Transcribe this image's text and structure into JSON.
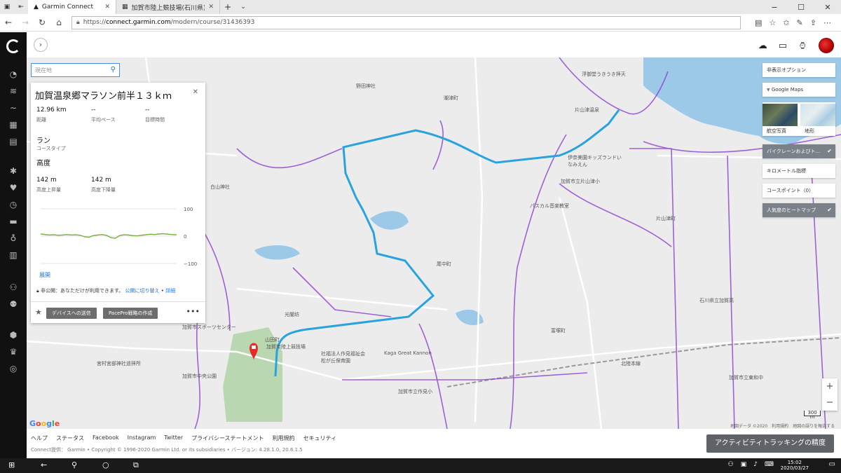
{
  "browser": {
    "tabs": [
      {
        "title": "Garmin Connect",
        "active": true
      },
      {
        "title": "加賀市陸上競技場(石川県)の",
        "active": false
      }
    ],
    "url_prefix": "https://",
    "url_host": "connect.garmin.com",
    "url_path": "/modern/course/31436393"
  },
  "search": {
    "placeholder": "現在地"
  },
  "course": {
    "title": "加賀温泉郷マラソン前半１３ｋｍ",
    "distance": {
      "value": "12.96 km",
      "label": "距離"
    },
    "avg_pace": {
      "value": "--",
      "label": "平均ペース"
    },
    "target_time": {
      "value": "--",
      "label": "目標時間"
    },
    "type": {
      "value": "ラン",
      "label": "コースタイプ"
    },
    "elevation_heading": "高度",
    "ascent": {
      "value": "142 m",
      "label": "高度上昇量"
    },
    "descent": {
      "value": "142 m",
      "label": "高度下降量"
    },
    "expand_link": "展開",
    "privacy_text": "非公開：あなただけが利用できます。",
    "privacy_link": "公開に切り替え",
    "details_link": "詳細",
    "send_button": "デバイスへの送信",
    "pacepro_button": "PacePro戦略の作成",
    "more": "•••"
  },
  "elevation_chart": {
    "type": "line",
    "y_ticks": [
      "100",
      "0",
      "−100"
    ],
    "ylim": [
      -100,
      100
    ],
    "values": [
      8,
      6,
      4,
      5,
      3,
      4,
      6,
      4,
      5,
      3,
      -2,
      -4,
      2,
      4,
      6,
      3,
      -5,
      -8,
      2,
      5,
      4,
      2,
      1,
      3,
      5,
      7,
      6,
      8,
      9,
      7,
      6,
      5
    ],
    "color": "#7cb342"
  },
  "right_panel": {
    "hide_options": "非表示オプション",
    "google_maps": "Google Maps",
    "satellite": "航空写真",
    "terrain": "地形",
    "bike_lanes": "バイクレーンおよびト...",
    "km_markers": "キロメートル指標",
    "course_points": "コースポイント（0）",
    "heatmap": "人気度のヒートマップ",
    "check": "✔"
  },
  "map": {
    "route_color": "#29a3e0",
    "labels": [
      {
        "text": "野田神社"
      },
      {
        "text": "潮津町"
      },
      {
        "text": "片山津温泉"
      },
      {
        "text": "浮御堂うきうき拝天"
      },
      {
        "text": "伊奈美園キッズランドいなみえん"
      },
      {
        "text": "加賀市立片山津小"
      },
      {
        "text": "パスカル音楽教室"
      },
      {
        "text": "白山神社"
      },
      {
        "text": "光闇坊"
      },
      {
        "text": "加賀市スポーツセンター"
      },
      {
        "text": "加賀市陸上競技場"
      },
      {
        "text": "社福法人作見福祉会 松が丘保育園"
      },
      {
        "text": "Kaga Great Kannon"
      },
      {
        "text": "加賀市立作見小"
      },
      {
        "text": "宮村宮部神社遥拝所"
      },
      {
        "text": "加賀市中央公園"
      },
      {
        "text": "石川県立加賀高"
      },
      {
        "text": "加賀市立東和中"
      },
      {
        "text": "北陸本線"
      },
      {
        "text": "片山津町"
      },
      {
        "text": "尾中町"
      },
      {
        "text": "富塚町"
      },
      {
        "text": "山田町"
      }
    ],
    "scale": "300 m",
    "attribution": "地図データ ©2020　利用規約　地図の誤りを報告する",
    "zoom_in": "+",
    "zoom_out": "−",
    "google": "Google"
  },
  "footer": {
    "links": [
      "ヘルプ",
      "ステータス",
      "Facebook",
      "Instagram",
      "Twitter",
      "プライバシーステートメント",
      "利用規約",
      "セキュリティ"
    ],
    "copyright": "Connect提供： Garmin • Copyright © 1996-2020 Garmin Ltd. or its subsidiaries • バージョン: 4.28.1.0, 20.6.1.5",
    "activity_button": "アクティビティトラッキングの精度"
  },
  "taskbar": {
    "time": "15:02",
    "date": "2020/03/27"
  }
}
